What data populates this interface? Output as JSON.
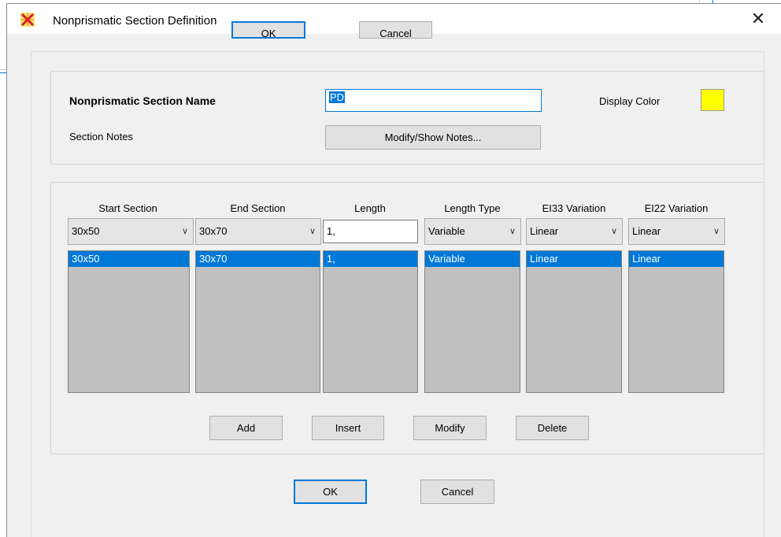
{
  "background": {
    "ok_label": "OK",
    "cancel_label": "Cancel"
  },
  "window": {
    "title": "Nonprismatic Section Definition",
    "close_symbol": "✕"
  },
  "section": {
    "name_label": "Nonprismatic Section Name",
    "name_value": "PD",
    "notes_label": "Section Notes",
    "notes_button": "Modify/Show Notes...",
    "display_color_label": "Display Color",
    "display_color": "#ffff00"
  },
  "table": {
    "headers": [
      "Start Section",
      "End Section",
      "Length",
      "Length Type",
      "EI33 Variation",
      "EI22 Variation"
    ],
    "inputs": [
      "30x50",
      "30x70",
      "1,",
      "Variable",
      "Linear",
      "Linear"
    ],
    "rows": [
      [
        "30x50",
        "30x70",
        "1,",
        "Variable",
        "Linear",
        "Linear"
      ]
    ]
  },
  "actions": {
    "add": "Add",
    "insert": "Insert",
    "modify": "Modify",
    "delete": "Delete"
  },
  "footer": {
    "ok": "OK",
    "cancel": "Cancel"
  },
  "colors": {
    "selection": "#0078d7",
    "list_bg": "#c0c0c0",
    "dialog_bg": "#f0f0f0"
  }
}
